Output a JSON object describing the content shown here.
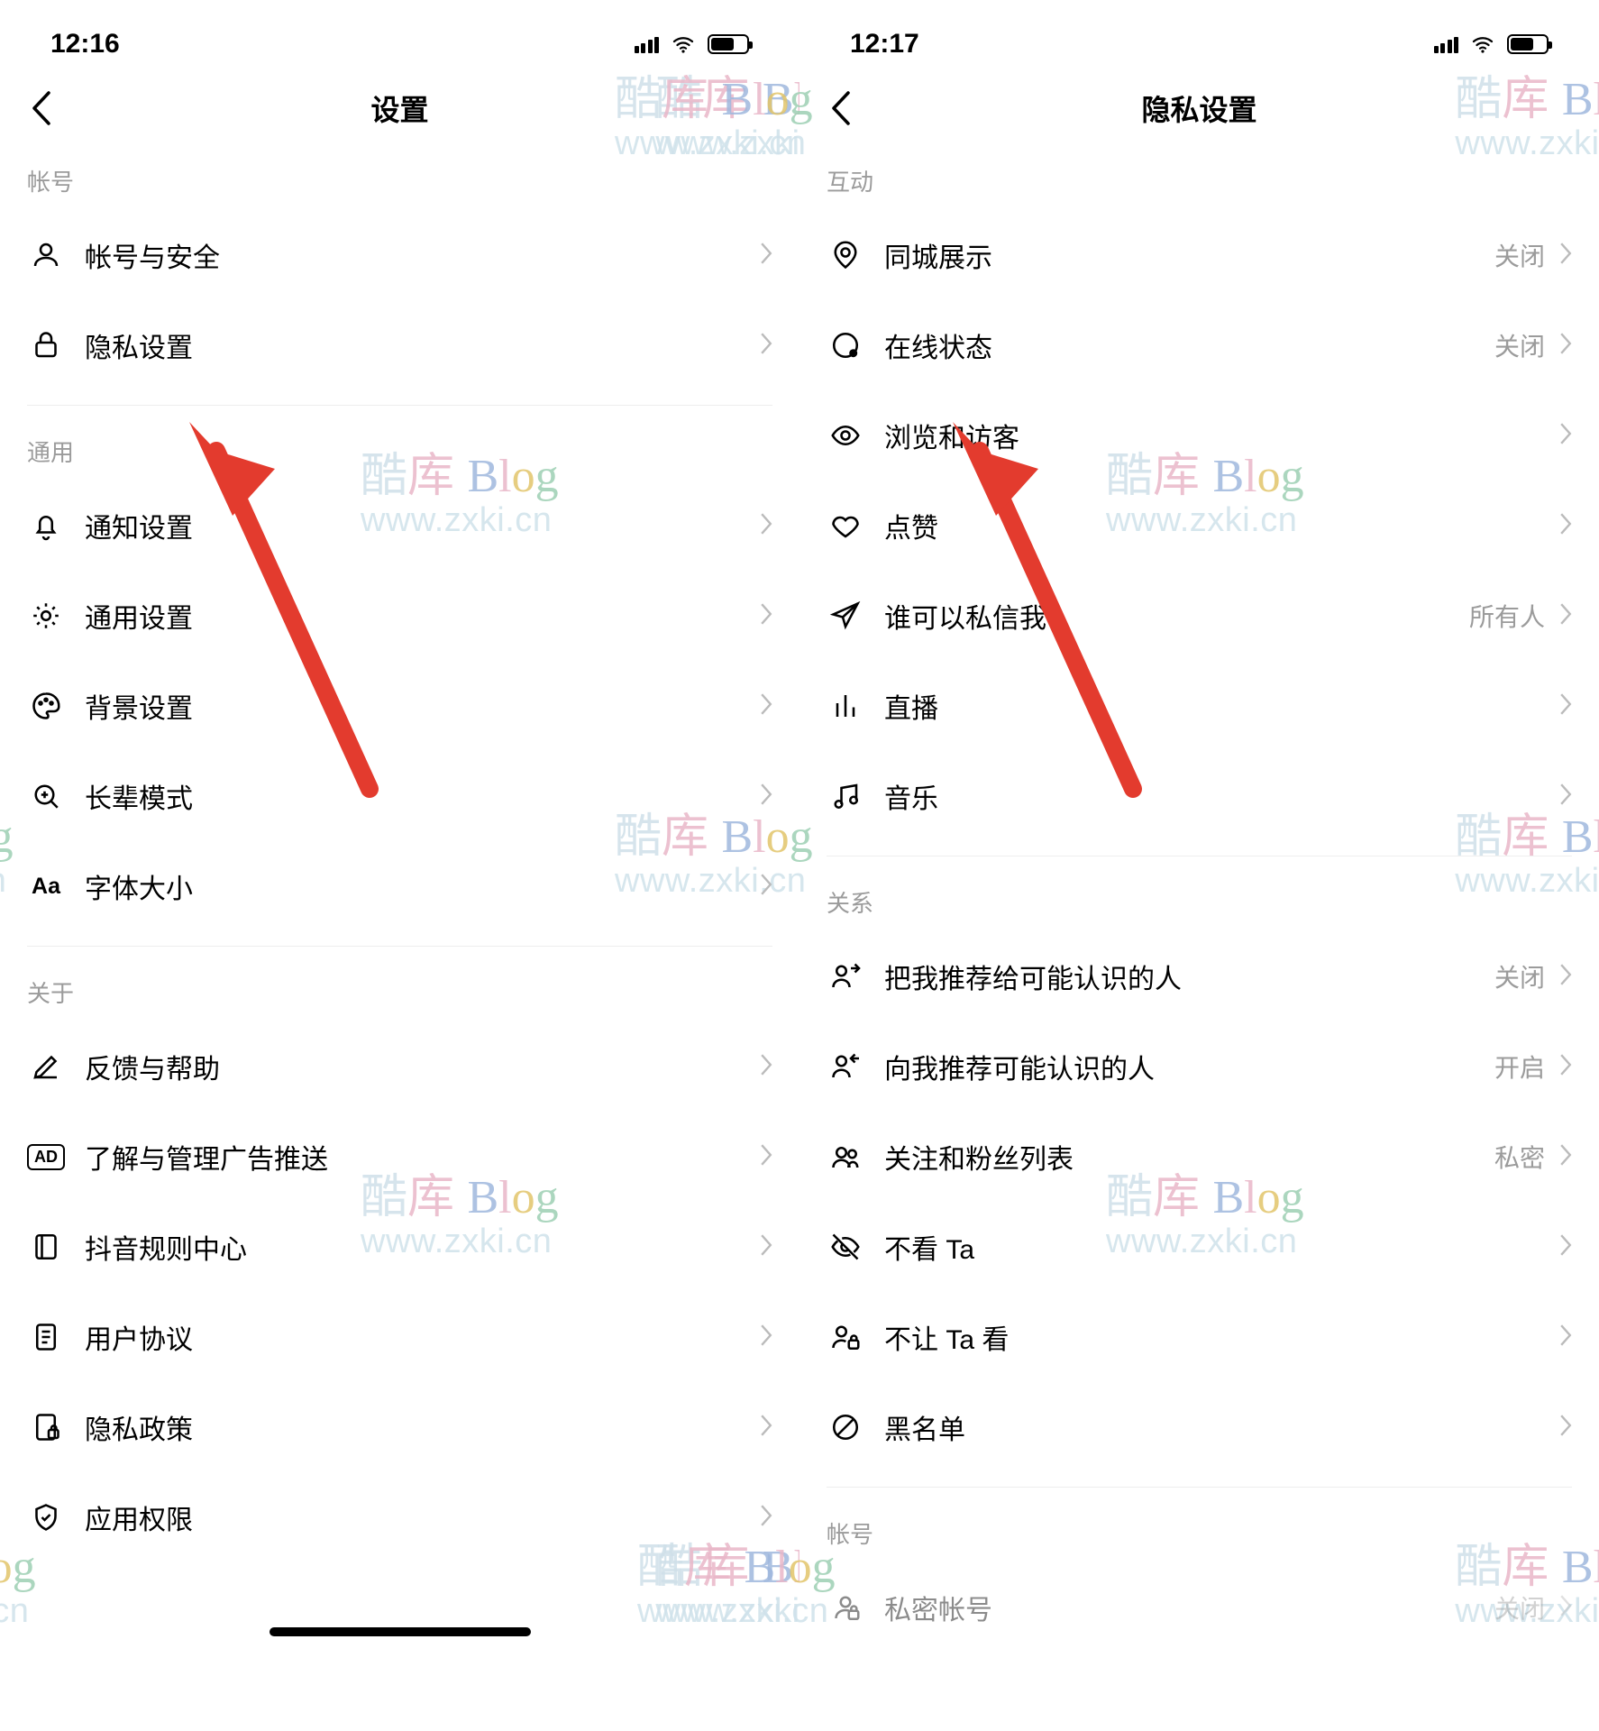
{
  "watermark": {
    "line1_a": "酷",
    "line1_b": "库",
    "B": "B",
    "l": "l",
    "o": "o",
    "g": "g",
    "line2": "www.zxki.cn"
  },
  "left": {
    "time": "12:16",
    "title": "设置",
    "sections": [
      {
        "label": "帐号",
        "items": [
          {
            "icon": "user",
            "label": "帐号与安全"
          },
          {
            "icon": "lock",
            "label": "隐私设置"
          }
        ]
      },
      {
        "label": "通用",
        "items": [
          {
            "icon": "bell",
            "label": "通知设置"
          },
          {
            "icon": "gear",
            "label": "通用设置"
          },
          {
            "icon": "palette",
            "label": "背景设置"
          },
          {
            "icon": "magnify",
            "label": "长辈模式"
          },
          {
            "icon": "aa",
            "label": "字体大小"
          }
        ]
      },
      {
        "label": "关于",
        "items": [
          {
            "icon": "pencil",
            "label": "反馈与帮助"
          },
          {
            "icon": "ad",
            "label": "了解与管理广告推送"
          },
          {
            "icon": "book",
            "label": "抖音规则中心"
          },
          {
            "icon": "doc",
            "label": "用户协议"
          },
          {
            "icon": "doclock",
            "label": "隐私政策"
          },
          {
            "icon": "shield",
            "label": "应用权限"
          }
        ]
      }
    ]
  },
  "right": {
    "time": "12:17",
    "title": "隐私设置",
    "sections": [
      {
        "label": "互动",
        "items": [
          {
            "icon": "pin",
            "label": "同城展示",
            "value": "关闭"
          },
          {
            "icon": "status",
            "label": "在线状态",
            "value": "关闭"
          },
          {
            "icon": "eye",
            "label": "浏览和访客"
          },
          {
            "icon": "heart",
            "label": "点赞"
          },
          {
            "icon": "send",
            "label": "谁可以私信我",
            "value": "所有人"
          },
          {
            "icon": "bars",
            "label": "直播"
          },
          {
            "icon": "music",
            "label": "音乐"
          }
        ]
      },
      {
        "label": "关系",
        "items": [
          {
            "icon": "rec-out",
            "label": "把我推荐给可能认识的人",
            "value": "关闭"
          },
          {
            "icon": "rec-in",
            "label": "向我推荐可能认识的人",
            "value": "开启"
          },
          {
            "icon": "people",
            "label": "关注和粉丝列表",
            "value": "私密"
          },
          {
            "icon": "eye-off",
            "label": "不看 Ta"
          },
          {
            "icon": "person-lock",
            "label": "不让 Ta 看"
          },
          {
            "icon": "ban",
            "label": "黑名单"
          }
        ]
      },
      {
        "label": "帐号",
        "items": [
          {
            "icon": "private",
            "label": "私密帐号",
            "value": "关闭"
          }
        ]
      }
    ]
  }
}
